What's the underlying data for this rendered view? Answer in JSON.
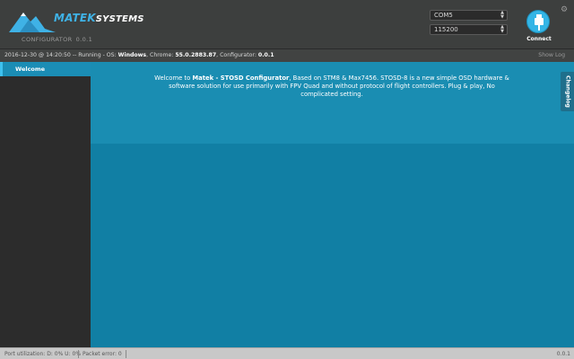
{
  "header": {
    "brand_primary": "MATEK",
    "brand_secondary": "SYSTEMS",
    "subtitle": "CONFIGURATOR",
    "version": "0.0.1",
    "port_select": {
      "value": "COM5"
    },
    "baud_select": {
      "value": "115200"
    },
    "connect_label": "Connect",
    "icons": {
      "logo": "mountain-logo-icon",
      "connect": "usb-plug-icon",
      "settings": "gear-icon"
    }
  },
  "logbar": {
    "prefix": "2016-12-30 @ 14:20:50 -- Running - OS: ",
    "os": "Windows",
    "chrome_label": ", Chrome: ",
    "chrome_version": "55.0.2883.87",
    "configurator_label": ", Configurator: ",
    "configurator_version": "0.0.1",
    "show_log": "Show Log"
  },
  "sidebar": {
    "tabs": [
      {
        "label": "Welcome",
        "active": true
      }
    ]
  },
  "main": {
    "welcome_prefix": "Welcome to ",
    "welcome_app": "Matek - STOSD Configurator",
    "welcome_rest": ", Based on STM8 & Max7456. STOSD-8 is a new simple OSD hardware & software solution for use primarily with FPV Quad and without protocol of flight controllers. Plug & play, No complicated setting.",
    "changelog_label": "Changelog"
  },
  "statusbar": {
    "port_utilization": "Port utilization: D: 0% U: 0%",
    "packet_error": "Packet error: 0",
    "version": "0.0.1"
  },
  "colors": {
    "accent": "#3fb2e6",
    "header_bg": "#3d3f3e",
    "main_top": "#1a8db2",
    "main_body": "#117fa4",
    "sidebar_bg": "#2c2c2c"
  }
}
